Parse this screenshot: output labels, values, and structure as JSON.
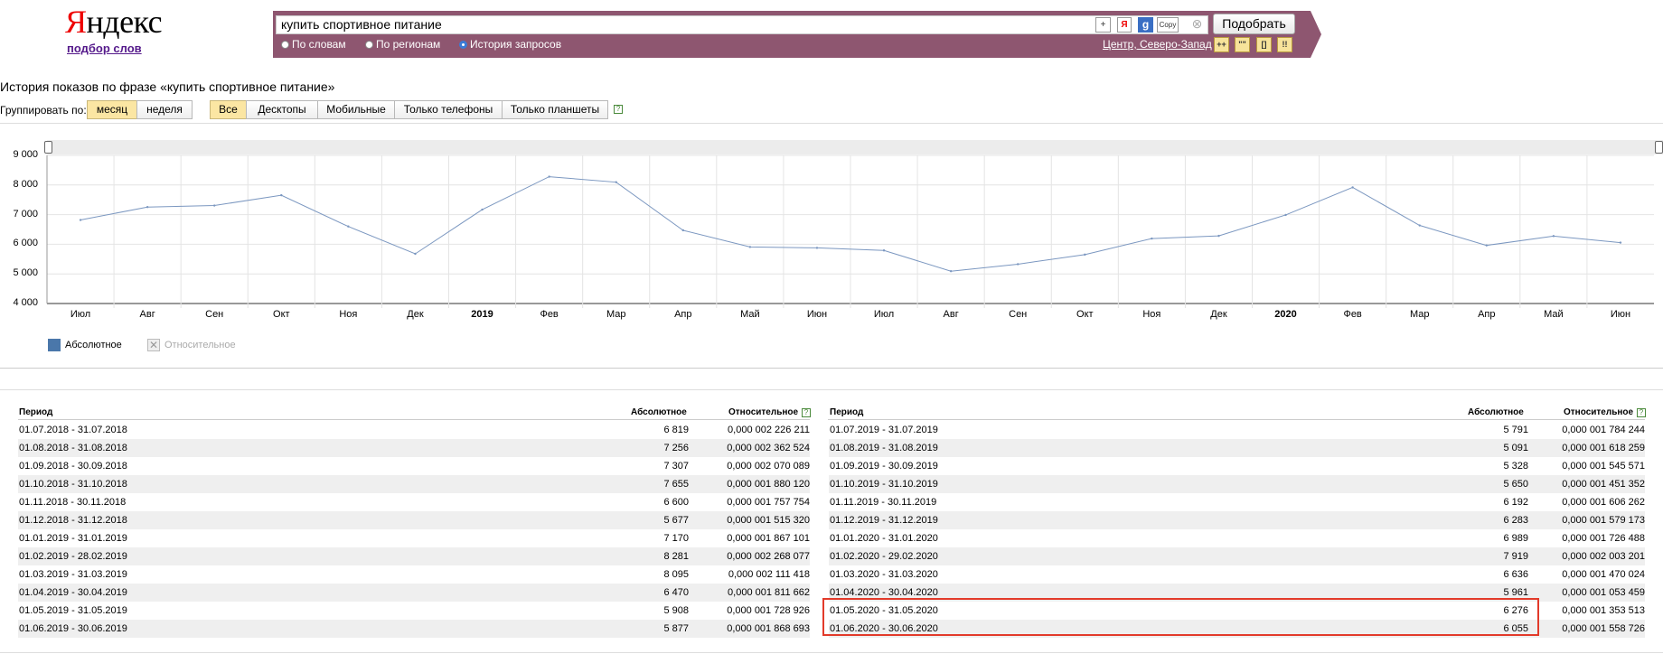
{
  "header": {
    "logo_red": "Я",
    "logo_rest": "ндекс",
    "logo_sub": "подбор слов",
    "search_value": "купить спортивное питание",
    "search_buttons": [
      "+",
      "Я",
      "g",
      "Copy",
      "⊗"
    ],
    "submit_label": "Подобрать",
    "modes": [
      "По словам",
      "По регионам",
      "История запросов"
    ],
    "region": "Центр, Северо-Запад",
    "tool_buttons": [
      "++",
      "\"\"",
      "[]",
      "!!"
    ]
  },
  "section": {
    "title": "История показов по фразе «купить спортивное питание»",
    "group_label": "Группировать по:",
    "group_options": [
      "месяц",
      "неделя"
    ],
    "device_options": [
      "Все",
      "Десктопы",
      "Мобильные",
      "Только телефоны",
      "Только планшеты"
    ],
    "help": "?"
  },
  "chart_data": {
    "type": "line",
    "x": [
      "Июл",
      "Авг",
      "Сен",
      "Окт",
      "Ноя",
      "Дек",
      "2019",
      "Фев",
      "Мар",
      "Апр",
      "Май",
      "Июн",
      "Июл",
      "Авг",
      "Сен",
      "Окт",
      "Ноя",
      "Дек",
      "2020",
      "Фев",
      "Мар",
      "Апр",
      "Май",
      "Июн"
    ],
    "bold_x": [
      "2019",
      "2020"
    ],
    "series": [
      {
        "name": "Абсолютное",
        "values": [
          6819,
          7256,
          7307,
          7655,
          6600,
          5677,
          7170,
          8281,
          8095,
          6470,
          5908,
          5877,
          5791,
          5091,
          5328,
          5650,
          6192,
          6283,
          6989,
          7919,
          6636,
          5961,
          6276,
          6055
        ]
      }
    ],
    "y_ticks": [
      "4 000",
      "5 000",
      "6 000",
      "7 000",
      "8 000",
      "9 000"
    ],
    "ylim": [
      4000,
      9000
    ],
    "grid": true,
    "line_color": "#7b97c0",
    "legend": [
      {
        "label": "Абсолютное",
        "color": "#4a77aa",
        "active": true
      },
      {
        "label": "Относительное",
        "color": "#cccccc",
        "active": false
      }
    ]
  },
  "table": {
    "headers": {
      "period": "Период",
      "absolute": "Абсолютное",
      "relative": "Относительное"
    },
    "left": [
      [
        "01.07.2018 - 31.07.2018",
        "6 819",
        "0,000 002 226 211"
      ],
      [
        "01.08.2018 - 31.08.2018",
        "7 256",
        "0,000 002 362 524"
      ],
      [
        "01.09.2018 - 30.09.2018",
        "7 307",
        "0,000 002 070 089"
      ],
      [
        "01.10.2018 - 31.10.2018",
        "7 655",
        "0,000 001 880 120"
      ],
      [
        "01.11.2018 - 30.11.2018",
        "6 600",
        "0,000 001 757 754"
      ],
      [
        "01.12.2018 - 31.12.2018",
        "5 677",
        "0,000 001 515 320"
      ],
      [
        "01.01.2019 - 31.01.2019",
        "7 170",
        "0,000 001 867 101"
      ],
      [
        "01.02.2019 - 28.02.2019",
        "8 281",
        "0,000 002 268 077"
      ],
      [
        "01.03.2019 - 31.03.2019",
        "8 095",
        "0,000 002 111 418"
      ],
      [
        "01.04.2019 - 30.04.2019",
        "6 470",
        "0,000 001 811 662"
      ],
      [
        "01.05.2019 - 31.05.2019",
        "5 908",
        "0,000 001 728 926"
      ],
      [
        "01.06.2019 - 30.06.2019",
        "5 877",
        "0,000 001 868 693"
      ]
    ],
    "right": [
      [
        "01.07.2019 - 31.07.2019",
        "5 791",
        "0,000 001 784 244"
      ],
      [
        "01.08.2019 - 31.08.2019",
        "5 091",
        "0,000 001 618 259"
      ],
      [
        "01.09.2019 - 30.09.2019",
        "5 328",
        "0,000 001 545 571"
      ],
      [
        "01.10.2019 - 31.10.2019",
        "5 650",
        "0,000 001 451 352"
      ],
      [
        "01.11.2019 - 30.11.2019",
        "6 192",
        "0,000 001 606 262"
      ],
      [
        "01.12.2019 - 31.12.2019",
        "6 283",
        "0,000 001 579 173"
      ],
      [
        "01.01.2020 - 31.01.2020",
        "6 989",
        "0,000 001 726 488"
      ],
      [
        "01.02.2020 - 29.02.2020",
        "7 919",
        "0,000 002 003 201"
      ],
      [
        "01.03.2020 - 31.03.2020",
        "6 636",
        "0,000 001 470 024"
      ],
      [
        "01.04.2020 - 30.04.2020",
        "5 961",
        "0,000 001 053 459"
      ],
      [
        "01.05.2020 - 31.05.2020",
        "6 276",
        "0,000 001 353 513"
      ],
      [
        "01.06.2020 - 30.06.2020",
        "6 055",
        "0,000 001 558 726"
      ]
    ],
    "highlight_color": "#e23a2a"
  }
}
